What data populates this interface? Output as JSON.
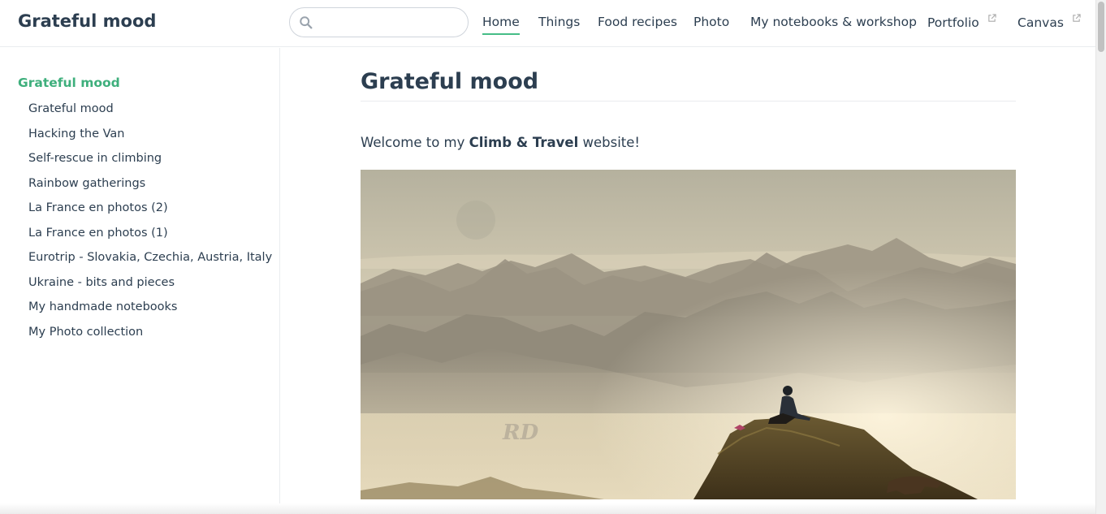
{
  "header": {
    "site_name": "Grateful mood",
    "search": {
      "value": "",
      "placeholder": ""
    },
    "nav": [
      {
        "label": "Home",
        "active": true,
        "external": false
      },
      {
        "label": "Things",
        "active": false,
        "external": false
      },
      {
        "label": "Food recipes",
        "active": false,
        "external": false
      },
      {
        "label": "Photo",
        "active": false,
        "external": false
      },
      {
        "label": "My notebooks & workshop",
        "active": false,
        "external": false
      },
      {
        "label": "Portfolio",
        "active": false,
        "external": true
      },
      {
        "label": "Canvas",
        "active": false,
        "external": true
      }
    ]
  },
  "sidebar": {
    "heading": "Grateful mood",
    "items": [
      "Grateful mood",
      "Hacking the Van",
      "Self-rescue in climbing",
      "Rainbow gatherings",
      "La France en photos (2)",
      "La France en photos (1)",
      "Eurotrip - Slovakia, Czechia, Austria, Italy",
      "Ukraine - bits and pieces",
      "My handmade notebooks",
      "My Photo collection"
    ]
  },
  "main": {
    "title": "Grateful mood",
    "welcome": {
      "before": "Welcome to my ",
      "bold": "Climb & Travel",
      "after": " website!"
    },
    "image": {
      "watermark": "RD"
    }
  },
  "colors": {
    "accent": "#3eaf7c",
    "text": "#2c3e50",
    "border": "#eaecef"
  }
}
